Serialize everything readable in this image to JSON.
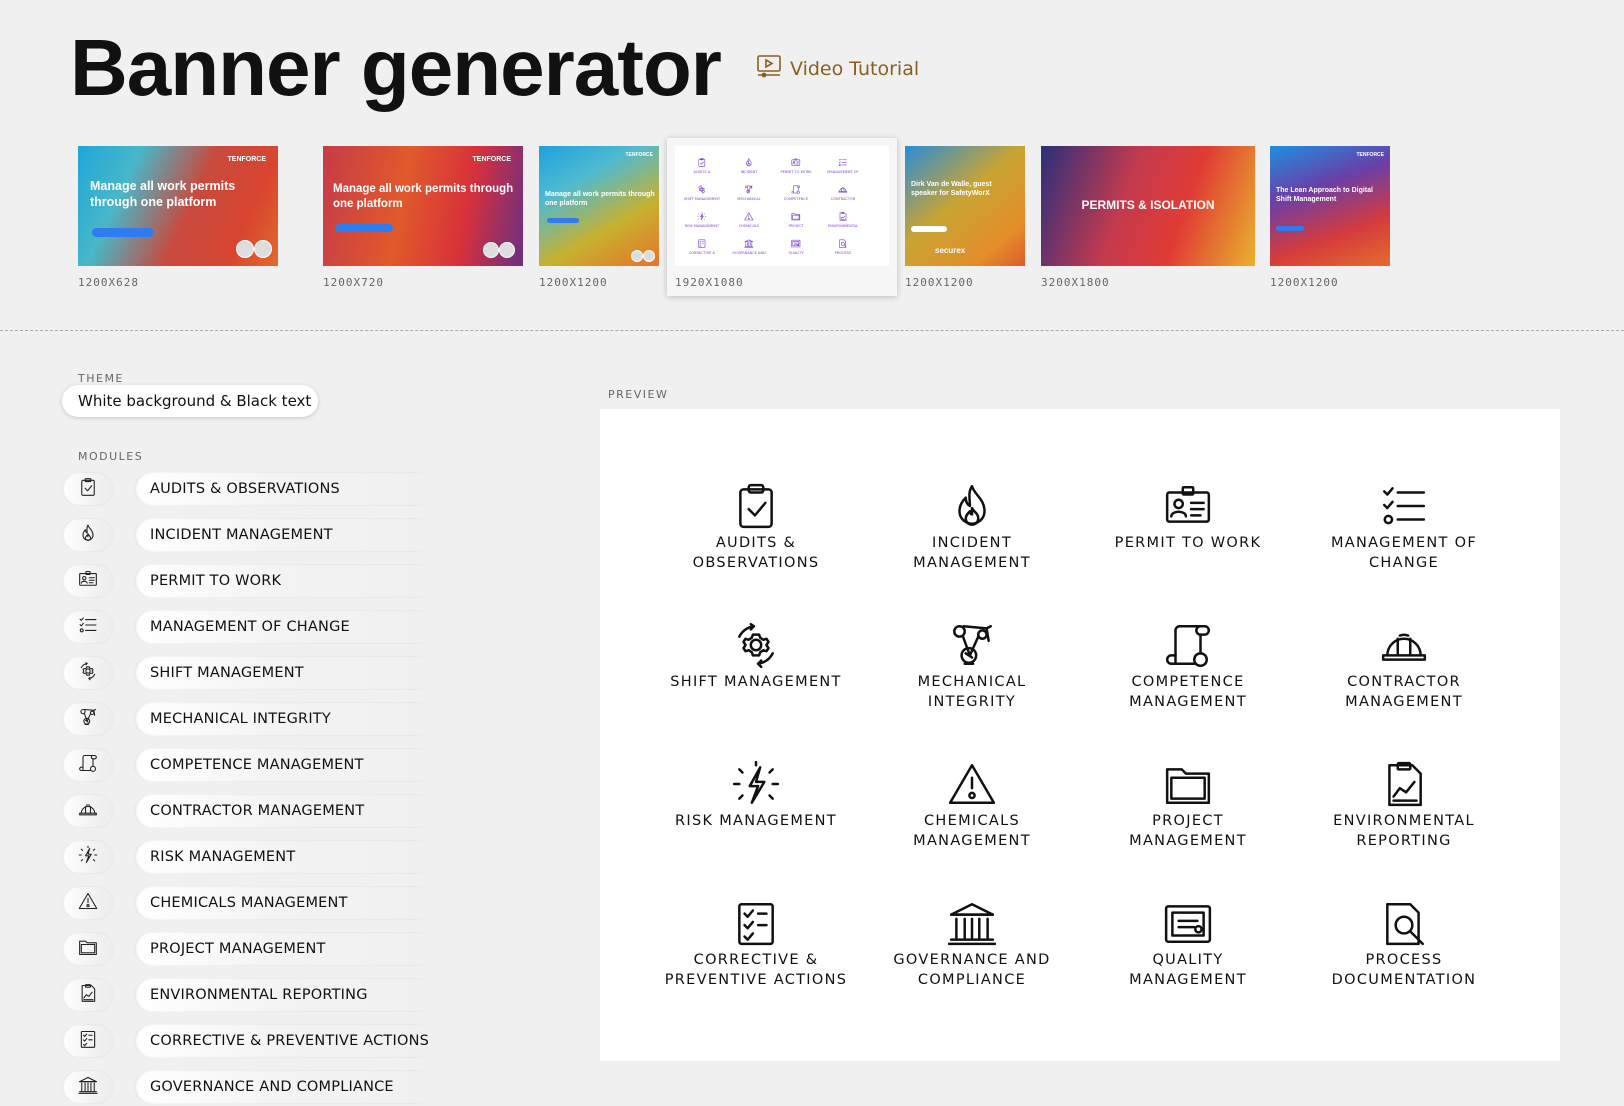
{
  "header": {
    "title": "Banner generator",
    "video_link": "Video Tutorial",
    "video_icon": "video-tutorial-icon"
  },
  "templates": [
    {
      "size": "1200X628",
      "headline": "Manage all work permits through one platform",
      "brand": "TENFORCE"
    },
    {
      "size": "1200X720",
      "headline": "Manage all work permits through one platform",
      "brand": "TENFORCE"
    },
    {
      "size": "1200X1200",
      "headline": "Manage all work permits through one platform",
      "brand": "TENFORCE"
    },
    {
      "size": "1920X1080",
      "selected": true
    },
    {
      "size": "1200X1200",
      "headline": "Dirk Van de Walle, guest speaker for SafetyWorX",
      "brand": "securex"
    },
    {
      "size": "3200X1800",
      "headline": "PERMITS & ISOLATION"
    },
    {
      "size": "1200X1200",
      "headline": "The Lean Approach to Digital Shift Management",
      "brand": "TENFORCE"
    }
  ],
  "theme": {
    "label": "THEME",
    "value": "White background & Black text"
  },
  "modules": {
    "label": "MODULES",
    "items": [
      {
        "label": "AUDITS & OBSERVATIONS",
        "icon": "clipboard-check-icon"
      },
      {
        "label": "INCIDENT MANAGEMENT",
        "icon": "flame-icon"
      },
      {
        "label": "PERMIT TO WORK",
        "icon": "id-card-icon"
      },
      {
        "label": "MANAGEMENT OF CHANGE",
        "icon": "checklist-icon"
      },
      {
        "label": "SHIFT MANAGEMENT",
        "icon": "gear-cycle-icon"
      },
      {
        "label": "MECHANICAL INTEGRITY",
        "icon": "robot-arm-icon"
      },
      {
        "label": "COMPETENCE MANAGEMENT",
        "icon": "certificate-scroll-icon"
      },
      {
        "label": "CONTRACTOR MANAGEMENT",
        "icon": "hard-hat-icon"
      },
      {
        "label": "RISK MANAGEMENT",
        "icon": "lightning-burst-icon"
      },
      {
        "label": "CHEMICALS MANAGEMENT",
        "icon": "warning-triangle-icon"
      },
      {
        "label": "PROJECT MANAGEMENT",
        "icon": "folder-icon"
      },
      {
        "label": "ENVIRONMENTAL REPORTING",
        "icon": "report-chart-icon"
      },
      {
        "label": "CORRECTIVE & PREVENTIVE ACTIONS",
        "icon": "checkbox-list-icon"
      },
      {
        "label": "GOVERNANCE AND COMPLIANCE",
        "icon": "institution-icon"
      }
    ]
  },
  "preview": {
    "label": "PREVIEW",
    "items": [
      {
        "line1": "AUDITS &",
        "line2": "OBSERVATIONS",
        "icon": "clipboard-check-icon"
      },
      {
        "line1": "INCIDENT",
        "line2": "MANAGEMENT",
        "icon": "flame-icon"
      },
      {
        "line1": "PERMIT TO WORK",
        "line2": "",
        "icon": "id-card-icon"
      },
      {
        "line1": "MANAGEMENT OF",
        "line2": "CHANGE",
        "icon": "checklist-icon"
      },
      {
        "line1": "SHIFT MANAGEMENT",
        "line2": "",
        "icon": "gear-cycle-icon"
      },
      {
        "line1": "MECHANICAL",
        "line2": "INTEGRITY",
        "icon": "robot-arm-icon"
      },
      {
        "line1": "COMPETENCE",
        "line2": "MANAGEMENT",
        "icon": "certificate-scroll-icon"
      },
      {
        "line1": "CONTRACTOR",
        "line2": "MANAGEMENT",
        "icon": "hard-hat-icon"
      },
      {
        "line1": "RISK MANAGEMENT",
        "line2": "",
        "icon": "lightning-burst-icon"
      },
      {
        "line1": "CHEMICALS",
        "line2": "MANAGEMENT",
        "icon": "warning-triangle-icon"
      },
      {
        "line1": "PROJECT",
        "line2": "MANAGEMENT",
        "icon": "folder-icon"
      },
      {
        "line1": "ENVIRONMENTAL",
        "line2": "REPORTING",
        "icon": "report-chart-icon"
      },
      {
        "line1": "CORRECTIVE &",
        "line2": "PREVENTIVE ACTIONS",
        "icon": "checkbox-list-icon"
      },
      {
        "line1": "GOVERNANCE AND",
        "line2": "COMPLIANCE",
        "icon": "institution-icon"
      },
      {
        "line1": "QUALITY",
        "line2": "MANAGEMENT",
        "icon": "quality-certificate-icon"
      },
      {
        "line1": "PROCESS",
        "line2": "DOCUMENTATION",
        "icon": "document-search-icon"
      }
    ]
  },
  "colors": {
    "link": "#8a6020",
    "background": "#f0f0f0",
    "preview_background": "#ffffff",
    "selected_icon_purple": "#7a3fd0"
  }
}
